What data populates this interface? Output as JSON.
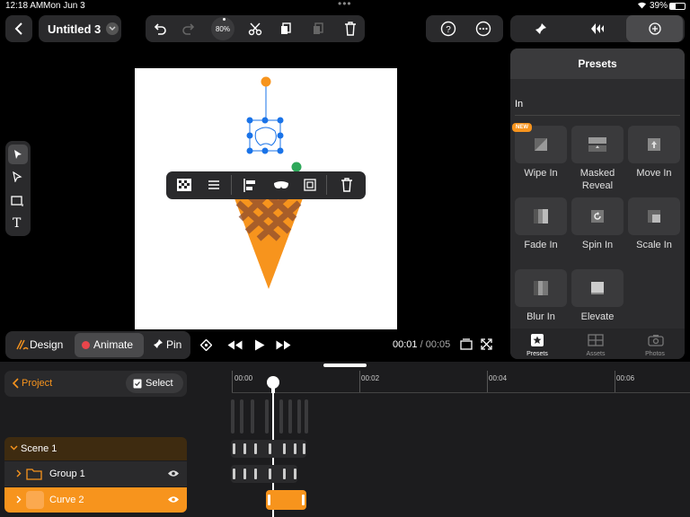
{
  "status_bar": {
    "time": "12:18 AM",
    "date": "Mon Jun 3",
    "battery": "39%"
  },
  "header": {
    "document_title": "Untitled 3",
    "zoom": "80%"
  },
  "presets_panel": {
    "title": "Presets",
    "section": "In",
    "new_badge": "NEW",
    "items": [
      {
        "label": "Wipe In"
      },
      {
        "label": "Masked\nReveal"
      },
      {
        "label": "Move In"
      },
      {
        "label": "Fade In"
      },
      {
        "label": "Spin In"
      },
      {
        "label": "Scale In"
      },
      {
        "label": "Blur In"
      },
      {
        "label": "Elevate"
      }
    ],
    "tabs": [
      {
        "label": "Presets"
      },
      {
        "label": "Assets"
      },
      {
        "label": "Photos"
      }
    ]
  },
  "mode_bar": {
    "design": "Design",
    "animate": "Animate",
    "pin": "Pin",
    "current_time": "00:01",
    "separator": " / ",
    "total_time": "00:05"
  },
  "timeline": {
    "project_label": "Project",
    "select_label": "Select",
    "ruler": [
      "00:00",
      "00:02",
      "00:04",
      "00:06"
    ],
    "layers": [
      {
        "name": "Scene 1"
      },
      {
        "name": "Group 1"
      },
      {
        "name": "Curve 2"
      }
    ]
  },
  "colors": {
    "accent": "#f7941d",
    "selection": "#1a73e8",
    "canvas": "#ffffff"
  }
}
